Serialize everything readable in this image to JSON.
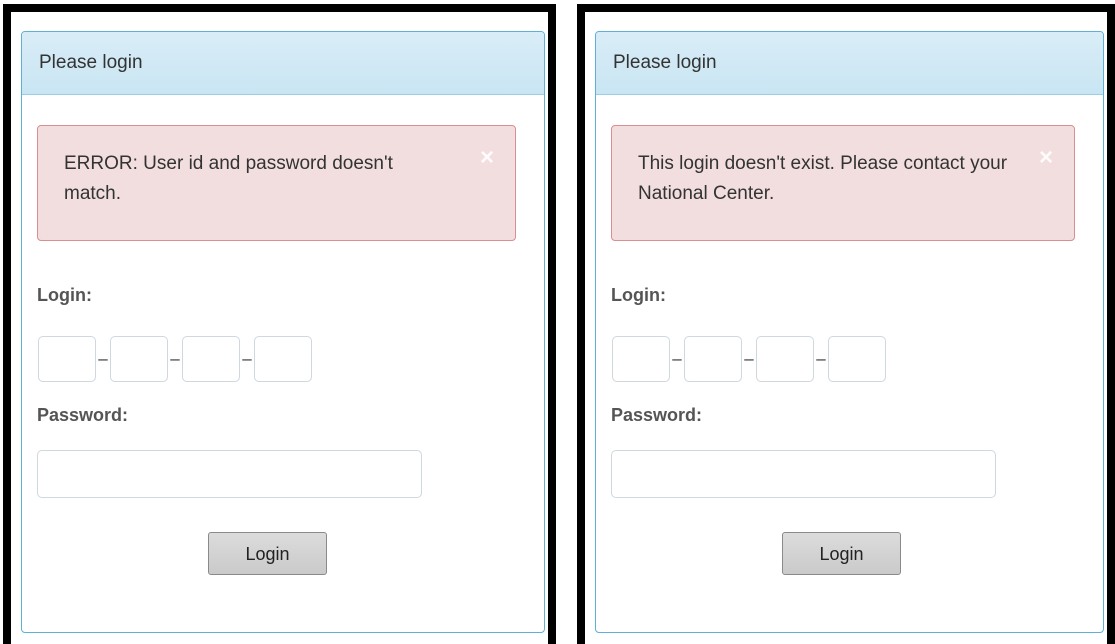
{
  "panels": [
    {
      "heading": "Please login",
      "alert_message": "ERROR: User id and password doesn't match.",
      "alert_close": "×",
      "login_label": "Login:",
      "login_separator": "–",
      "password_label": "Password:",
      "login_button": "Login"
    },
    {
      "heading": "Please login",
      "alert_message": "This login doesn't exist. Please contact your National Center.",
      "alert_close": "×",
      "login_label": "Login:",
      "login_separator": "–",
      "password_label": "Password:",
      "login_button": "Login"
    }
  ],
  "colors": {
    "frame_border": "#000000",
    "panel_border": "#5fb0d5",
    "heading_background": "#d9edf7",
    "alert_background": "#f2dede",
    "alert_border": "#d98f8f"
  }
}
